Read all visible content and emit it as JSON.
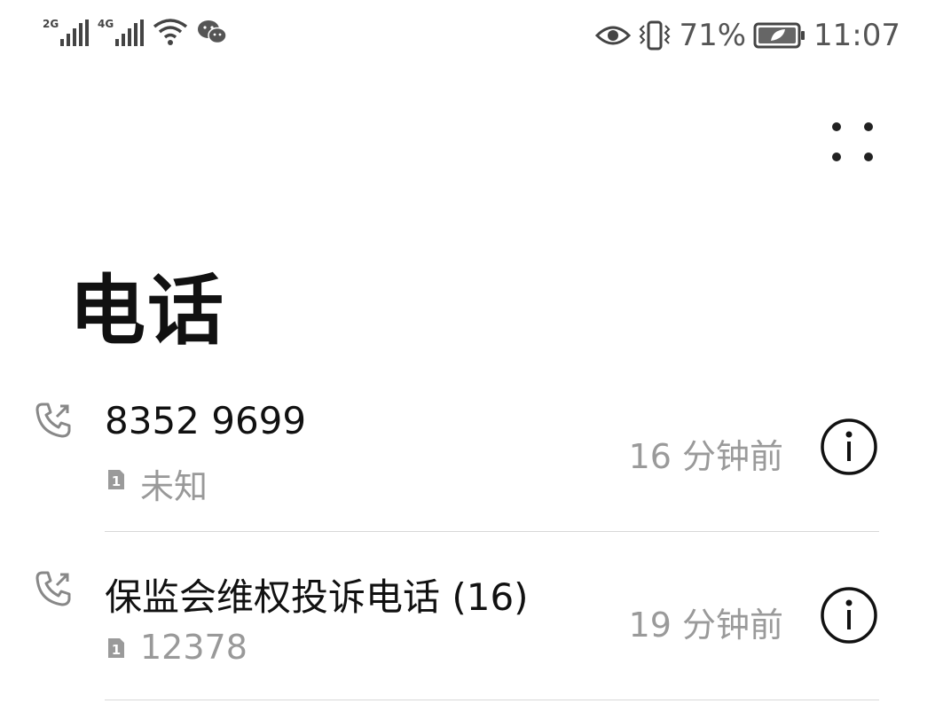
{
  "status_bar": {
    "sim1_network": "2G",
    "sim2_network": "4G",
    "battery_percent": "71%",
    "time": "11:07",
    "icons": [
      "signal-icon",
      "signal-icon",
      "wifi-icon",
      "wechat-icon",
      "eye-icon",
      "vibrate-icon",
      "battery-icon"
    ]
  },
  "header": {
    "title": "电话",
    "more_icon": "more-dots-icon"
  },
  "calls": [
    {
      "name": "8352 9699",
      "sim": "1",
      "subtitle": "未知",
      "time": "16 分钟前",
      "icon": "outgoing-call-icon"
    },
    {
      "name": "保监会维权投诉电话 (16)",
      "sim": "1",
      "subtitle": "12378",
      "time": "19 分钟前",
      "icon": "outgoing-call-icon"
    }
  ]
}
